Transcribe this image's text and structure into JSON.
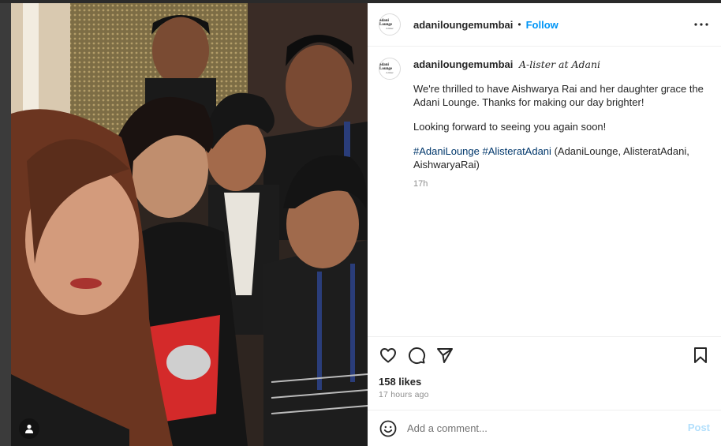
{
  "post": {
    "username": "adaniloungemumbai",
    "follow_label": "Follow",
    "separator": "•",
    "more_label": "•••",
    "avatar_logo_line1": "adani Lounge",
    "avatar_logo_line2": "A-lister"
  },
  "caption": {
    "username": "adaniloungemumbai",
    "title": "A-lister at Adani",
    "line1": "We're thrilled to have Aishwarya Rai and her daughter grace the Adani Lounge. Thanks for making our day brighter!",
    "line2": "Looking forward to seeing you again soon!",
    "hashtag1": "#AdaniLounge",
    "hashtag2": "#AlisteratAdani",
    "hashtag_tail": "(AdaniLounge, AlisteratAdani, AishwaryaRai)",
    "time": "17h"
  },
  "stats": {
    "likes": "158 likes",
    "time_ago": "17 hours ago"
  },
  "comment": {
    "placeholder": "Add a comment...",
    "post_label": "Post"
  },
  "icons": {
    "like": "heart-icon",
    "comment": "comment-icon",
    "share": "send-icon",
    "save": "bookmark-icon",
    "emoji": "emoji-icon",
    "tag": "user-tag-icon"
  },
  "colors": {
    "accent": "#0095f6",
    "hashtag": "#00376b",
    "post_disabled": "#b2dffc"
  }
}
